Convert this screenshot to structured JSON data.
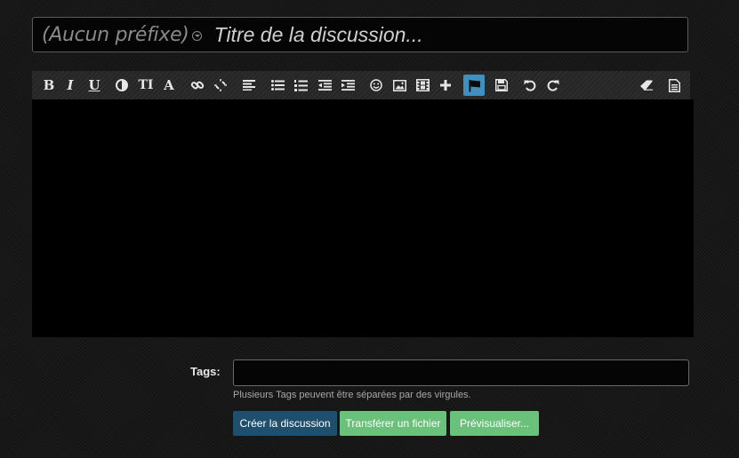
{
  "title_bar": {
    "prefix_label": "(Aucun préfixe)",
    "title_placeholder": "Titre de la discussion..."
  },
  "toolbar": {
    "bold_glyph": "B",
    "italic_glyph": "I",
    "underline_glyph": "U",
    "font_size_glyph": "TI",
    "font_glyph": "A",
    "active_color": "#3f8fbf",
    "icons": [
      "bold-icon",
      "italic-icon",
      "underline-icon",
      "color-icon",
      "font-size-icon",
      "font-icon",
      "link-icon",
      "unlink-icon",
      "align-icon",
      "bullet-list-icon",
      "numbered-list-icon",
      "outdent-icon",
      "indent-icon",
      "smiley-icon",
      "image-icon",
      "media-icon",
      "plus-icon",
      "flag-icon",
      "save-icon",
      "undo-icon",
      "redo-icon",
      "eraser-icon",
      "document-icon"
    ]
  },
  "tags": {
    "label": "Tags:",
    "value": "",
    "hint": "Plusieurs Tags peuvent être séparées par des virgules."
  },
  "buttons": {
    "create": "Créer la discussion",
    "upload": "Transférer un fichier",
    "preview": "Prévisualiser..."
  },
  "colors": {
    "create_button": "#1e4f6d",
    "secondary_button": "#69c17a"
  }
}
